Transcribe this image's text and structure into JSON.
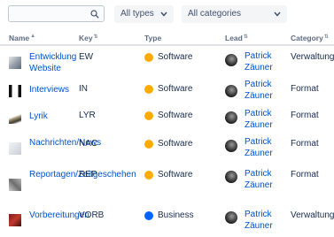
{
  "filters": {
    "search_placeholder": "",
    "types_label": "All types",
    "categories_label": "All categories"
  },
  "table": {
    "headers": {
      "name": "Name",
      "key": "Key",
      "type": "Type",
      "lead": "Lead",
      "category": "Category"
    },
    "rows": [
      {
        "name": "Entwicklung Website",
        "key": "EW",
        "type": "Software",
        "type_icon": "software-icon",
        "lead": "Patrick Zäuner",
        "category": "Verwaltung"
      },
      {
        "name": "Interviews",
        "key": "IN",
        "type": "Software",
        "type_icon": "software-icon",
        "lead": "Patrick Zäuner",
        "category": "Format"
      },
      {
        "name": "Lyrik",
        "key": "LYR",
        "type": "Software",
        "type_icon": "software-icon",
        "lead": "Patrick Zäuner",
        "category": "Format"
      },
      {
        "name": "Nachrichten/News",
        "key": "NAC",
        "type": "Software",
        "type_icon": "software-icon",
        "lead": "Patrick Zäuner",
        "category": "Format"
      },
      {
        "name": "Reportagen/Zeitgeschehen",
        "key": "REP",
        "type": "Software",
        "type_icon": "software-icon",
        "lead": "Patrick Zäuner",
        "category": "Format"
      },
      {
        "name": "Vorbereitungen",
        "key": "VORB",
        "type": "Business",
        "type_icon": "business-icon",
        "lead": "Patrick Zäuner",
        "category": "Verwaltung"
      }
    ]
  },
  "colors": {
    "link": "#0052cc",
    "software": "#ffab00",
    "business": "#0065ff"
  }
}
